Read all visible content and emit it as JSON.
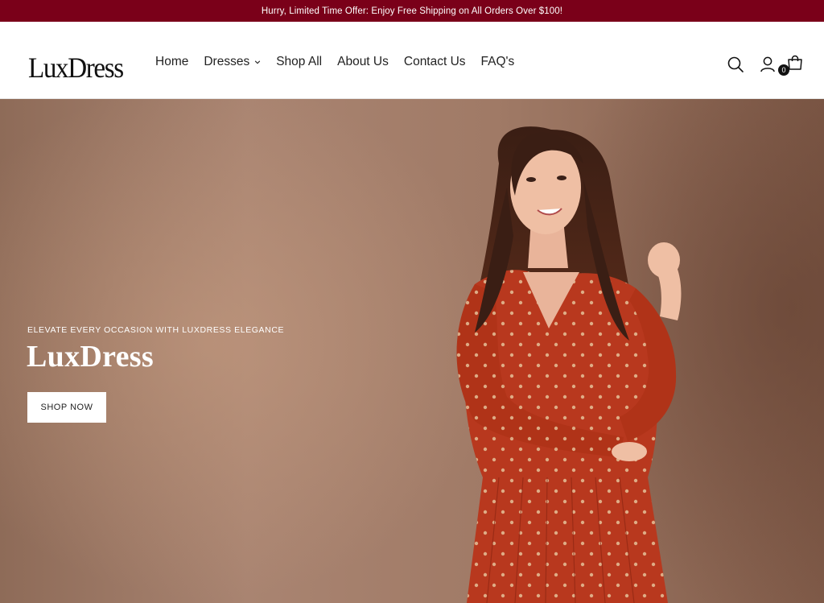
{
  "announcement": {
    "text": "Hurry, Limited Time Offer: Enjoy Free Shipping on All Orders Over $100!"
  },
  "header": {
    "logo": "LuxDress",
    "nav": [
      {
        "label": "Home"
      },
      {
        "label": "Dresses",
        "has_dropdown": true
      },
      {
        "label": "Shop All"
      },
      {
        "label": "About Us"
      },
      {
        "label": "Contact Us"
      },
      {
        "label": "FAQ's"
      }
    ],
    "icons": [
      "search-icon",
      "account-icon",
      "cart-icon"
    ],
    "cart_count": "0"
  },
  "hero": {
    "eyebrow": "ELEVATE EVERY OCCASION WITH LUXDRESS ELEGANCE",
    "title": "LuxDress",
    "cta_label": "SHOP NOW"
  },
  "colors": {
    "announcement_bg": "#7a0019",
    "hero_bg": "#a07a66",
    "dress": "#b8381e"
  }
}
